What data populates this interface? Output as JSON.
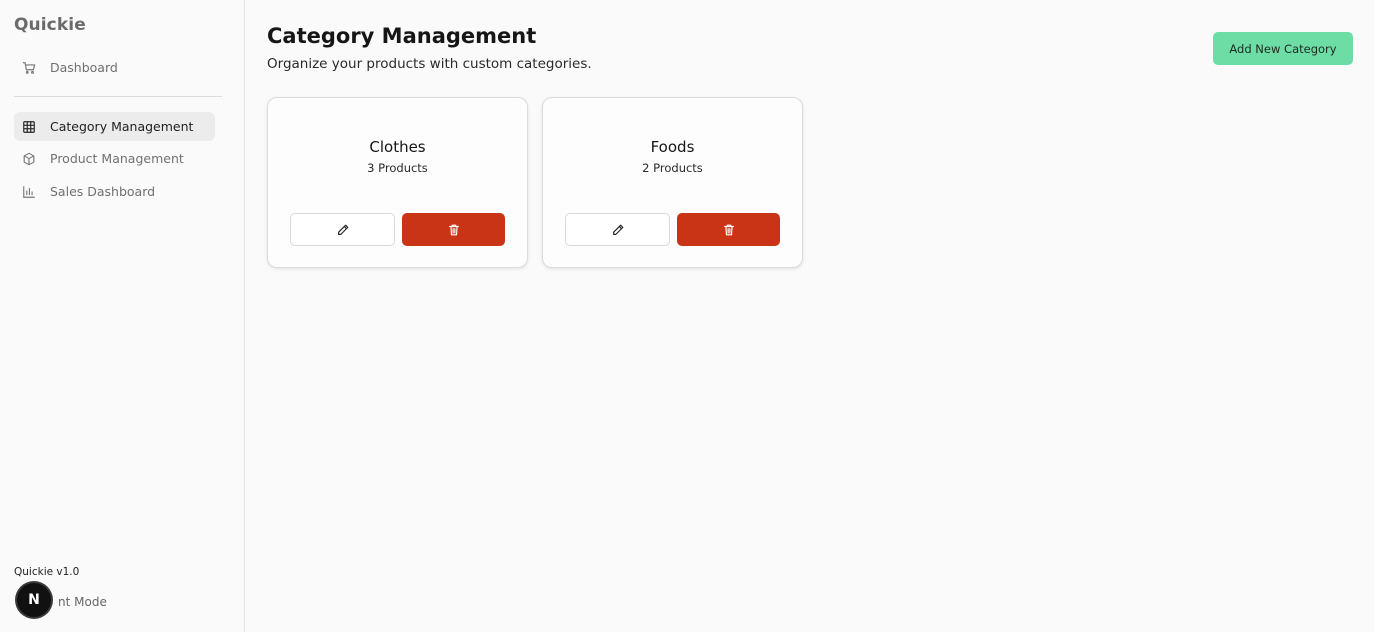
{
  "sidebar": {
    "brand": "Quickie",
    "items": [
      {
        "label": "Dashboard",
        "icon": "cart-icon"
      },
      {
        "label": "Category Management",
        "icon": "grid-icon",
        "active": true
      },
      {
        "label": "Product Management",
        "icon": "box-icon"
      },
      {
        "label": "Sales Dashboard",
        "icon": "bar-chart-icon"
      }
    ],
    "version": "Quickie v1.0",
    "mode_label": "nt Mode",
    "badge": "N"
  },
  "header": {
    "title": "Category Management",
    "subtitle": "Organize your products with custom categories.",
    "add_button": "Add New Category"
  },
  "categories": [
    {
      "name": "Clothes",
      "count": "3 Products"
    },
    {
      "name": "Foods",
      "count": "2 Products"
    }
  ],
  "colors": {
    "accent_green": "#6ddca5",
    "danger_red": "#c93316"
  }
}
